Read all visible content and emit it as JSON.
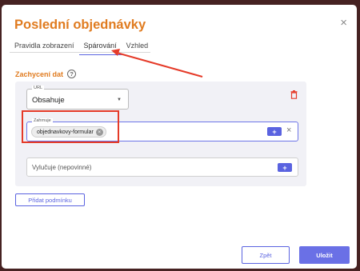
{
  "dialog": {
    "title": "Poslední objednávky",
    "close_symbol": "×"
  },
  "tabs": [
    {
      "label": "Pravidla zobrazení",
      "active": false
    },
    {
      "label": "Spárování",
      "active": true
    },
    {
      "label": "Vzhled",
      "active": false
    }
  ],
  "section": {
    "label": "Zachycení dat",
    "help_symbol": "?"
  },
  "url_field": {
    "legend": "URL",
    "value": "Obsahuje",
    "caret": "▼"
  },
  "contains_field": {
    "legend": "Zahrnuje",
    "chip_value": "objednavkovy-formular",
    "chip_remove_symbol": "×",
    "add_symbol": "+",
    "clear_symbol": "×"
  },
  "excludes_field": {
    "placeholder": "Vylučuje (nepovinné)",
    "add_symbol": "+"
  },
  "buttons": {
    "add_condition": "Přidat podmínku",
    "back": "Zpět",
    "save": "Uložit"
  },
  "colors": {
    "accent": "#e07b1f",
    "primary": "#5a63e0",
    "annotation_red": "#e53a28",
    "delete_red": "#e53a28"
  }
}
